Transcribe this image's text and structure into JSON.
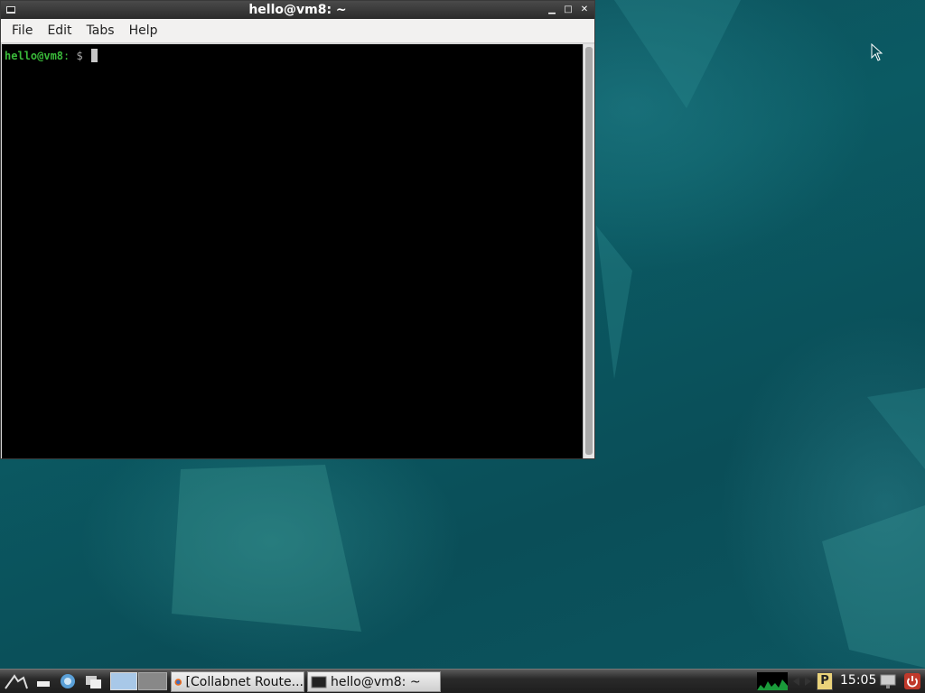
{
  "window": {
    "title": "hello@vm8: ~",
    "menu": [
      "File",
      "Edit",
      "Tabs",
      "Help"
    ]
  },
  "terminal": {
    "prompt_user": "hello@vm8",
    "prompt_sep": ":",
    "prompt_dollar": " $ "
  },
  "taskbar": {
    "tasks": [
      "[Collabnet Route...",
      "hello@vm8: ~"
    ],
    "clock": "15:05",
    "indicator_letter": "P"
  },
  "colors": {
    "desktop": "#0b5a63",
    "prompt_green": "#3aba3a",
    "taskbar": "#1e1e1e"
  }
}
